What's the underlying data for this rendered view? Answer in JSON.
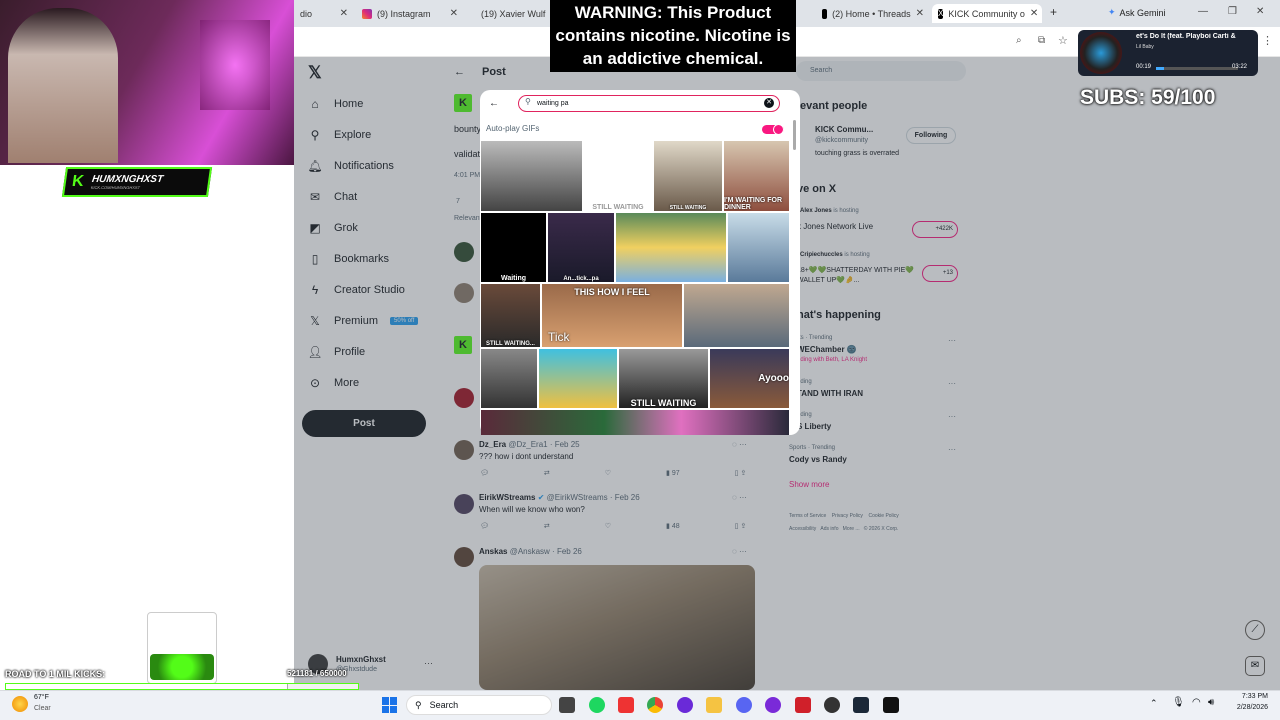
{
  "browser": {
    "tabs": [
      {
        "label": "dio",
        "icon": "tab-icon"
      },
      {
        "label": "(9) Instagram",
        "icon": "instagram-icon"
      },
      {
        "label": "(19) Xavier Wulf",
        "icon": "youtube-icon"
      },
      {
        "label": "(2) Home • Threads",
        "icon": "threads-icon"
      },
      {
        "label": "KICK Community o",
        "icon": "x-icon"
      }
    ],
    "ask_gemini": "Ask Gemini",
    "new_tab_symbol": "+"
  },
  "x_nav": {
    "items": [
      {
        "label": "Home",
        "icon": "home-icon"
      },
      {
        "label": "Explore",
        "icon": "search-icon"
      },
      {
        "label": "Notifications",
        "icon": "bell-icon"
      },
      {
        "label": "Chat",
        "icon": "mail-icon"
      },
      {
        "label": "Grok",
        "icon": "grok-icon"
      },
      {
        "label": "Bookmarks",
        "icon": "bookmark-icon"
      },
      {
        "label": "Creator Studio",
        "icon": "lightning-icon"
      },
      {
        "label": "Premium",
        "icon": "x-icon",
        "badge": "50% off"
      },
      {
        "label": "Profile",
        "icon": "person-icon"
      },
      {
        "label": "More",
        "icon": "more-icon"
      }
    ],
    "post_button": "Post",
    "account_name": "HumxnGhxst",
    "account_handle": "@Ghxstdude"
  },
  "header": {
    "title": "Post"
  },
  "tweets": [
    {
      "name": "Dz_Era",
      "handle": "@Dz_Era1 · Feb 25",
      "text": "??? how i dont understand",
      "views": "97"
    },
    {
      "name": "EirikWStreams",
      "handle": "@EirikWStreams · Feb 26",
      "text": "When will we know who won?",
      "views": "48"
    },
    {
      "name": "Anskas",
      "handle": "@Anskasw · Feb 26",
      "text": "",
      "views": ""
    }
  ],
  "partial_texts": {
    "boun": "bounty",
    "valid": "validat",
    "time": "4:01 PM",
    "relev": "Relevant",
    "reply_count": "7"
  },
  "gif_modal": {
    "search_value": "waiting pa",
    "autoplay_label": "Auto-play GIFs",
    "autoplay_on": true,
    "gifs": [
      {
        "caption": ""
      },
      {
        "caption": "STILL WAITING"
      },
      {
        "caption": "STILL WAITING"
      },
      {
        "caption": "I'M WAITING FOR DINNER"
      },
      {
        "caption": "Waiting"
      },
      {
        "caption": "An...tick...pa"
      },
      {
        "caption": ""
      },
      {
        "caption": ""
      },
      {
        "caption": "STILL WAITING..."
      },
      {
        "caption": "THIS HOW I FEEL"
      },
      {
        "caption": "Tick"
      },
      {
        "caption": ""
      },
      {
        "caption": ""
      },
      {
        "caption": ""
      },
      {
        "caption": "STILL WAITING"
      },
      {
        "caption": "Ayooo"
      }
    ]
  },
  "right_column": {
    "search_placeholder": "Search",
    "relevant_title": "levant people",
    "relevant_name": "KICK Commu...",
    "relevant_handle": "@kickcommunity",
    "relevant_bio": "touching grass is overrated",
    "following_label": "Following",
    "live_title": "ve on X",
    "live": [
      {
        "host": "Alex Jones",
        "status": "is hosting",
        "title": "x Jones Network Live",
        "count": "+422K"
      },
      {
        "host": "Cripiechuccles",
        "status": "is hosting",
        "title": "18+💚💚SHATTERDAY WITH PIE💚WALLET UP💚🤌...",
        "count": "+13"
      }
    ],
    "happening_title": "hat's happening",
    "trends": [
      {
        "cat": "rts · Trending",
        "name": "WEChamber 🌚",
        "sub": "nding with Beth, LA Knight"
      },
      {
        "cat": "nding",
        "name": "TAND WITH IRAN",
        "sub": ""
      },
      {
        "cat": "nding",
        "name": "S Liberty",
        "sub": ""
      },
      {
        "cat": "Sports · Trending",
        "name": "Cody vs Randy",
        "sub": ""
      }
    ],
    "show_more": "Show more",
    "footer": [
      "Terms of Service",
      "Privacy Policy",
      "Cookie Policy",
      "Accessibility",
      "Ads info",
      "More ...",
      "© 2026 X Corp."
    ]
  },
  "overlays": {
    "warning": "WARNING: This Product contains nicotine. Nicotine is an addictive chemical.",
    "subs": "SUBS: 59/100",
    "road_label": "ROAD TO 1 MIL KICKS:",
    "road_count": "521181 / 650000",
    "road_progress": 0.8018,
    "webcam_brand": "HUMXNGHXST",
    "webcam_url": "KICK.COM/HUMXNGHXST",
    "music_title": "et's Do It (feat. Playboi Carti &",
    "music_artist": "Lil Baby",
    "music_elapsed": "00:19",
    "music_total": "03:22",
    "music_progress": 0.095
  },
  "taskbar": {
    "weather_temp": "67°F",
    "weather_desc": "Clear",
    "search_label": "Search",
    "time": "7:33 PM",
    "date": "2/28/2026"
  },
  "colors": {
    "accent": "#1d9bf0",
    "pink": "#f91880",
    "dark": "#0f1419",
    "kick_green": "#53fc18"
  }
}
